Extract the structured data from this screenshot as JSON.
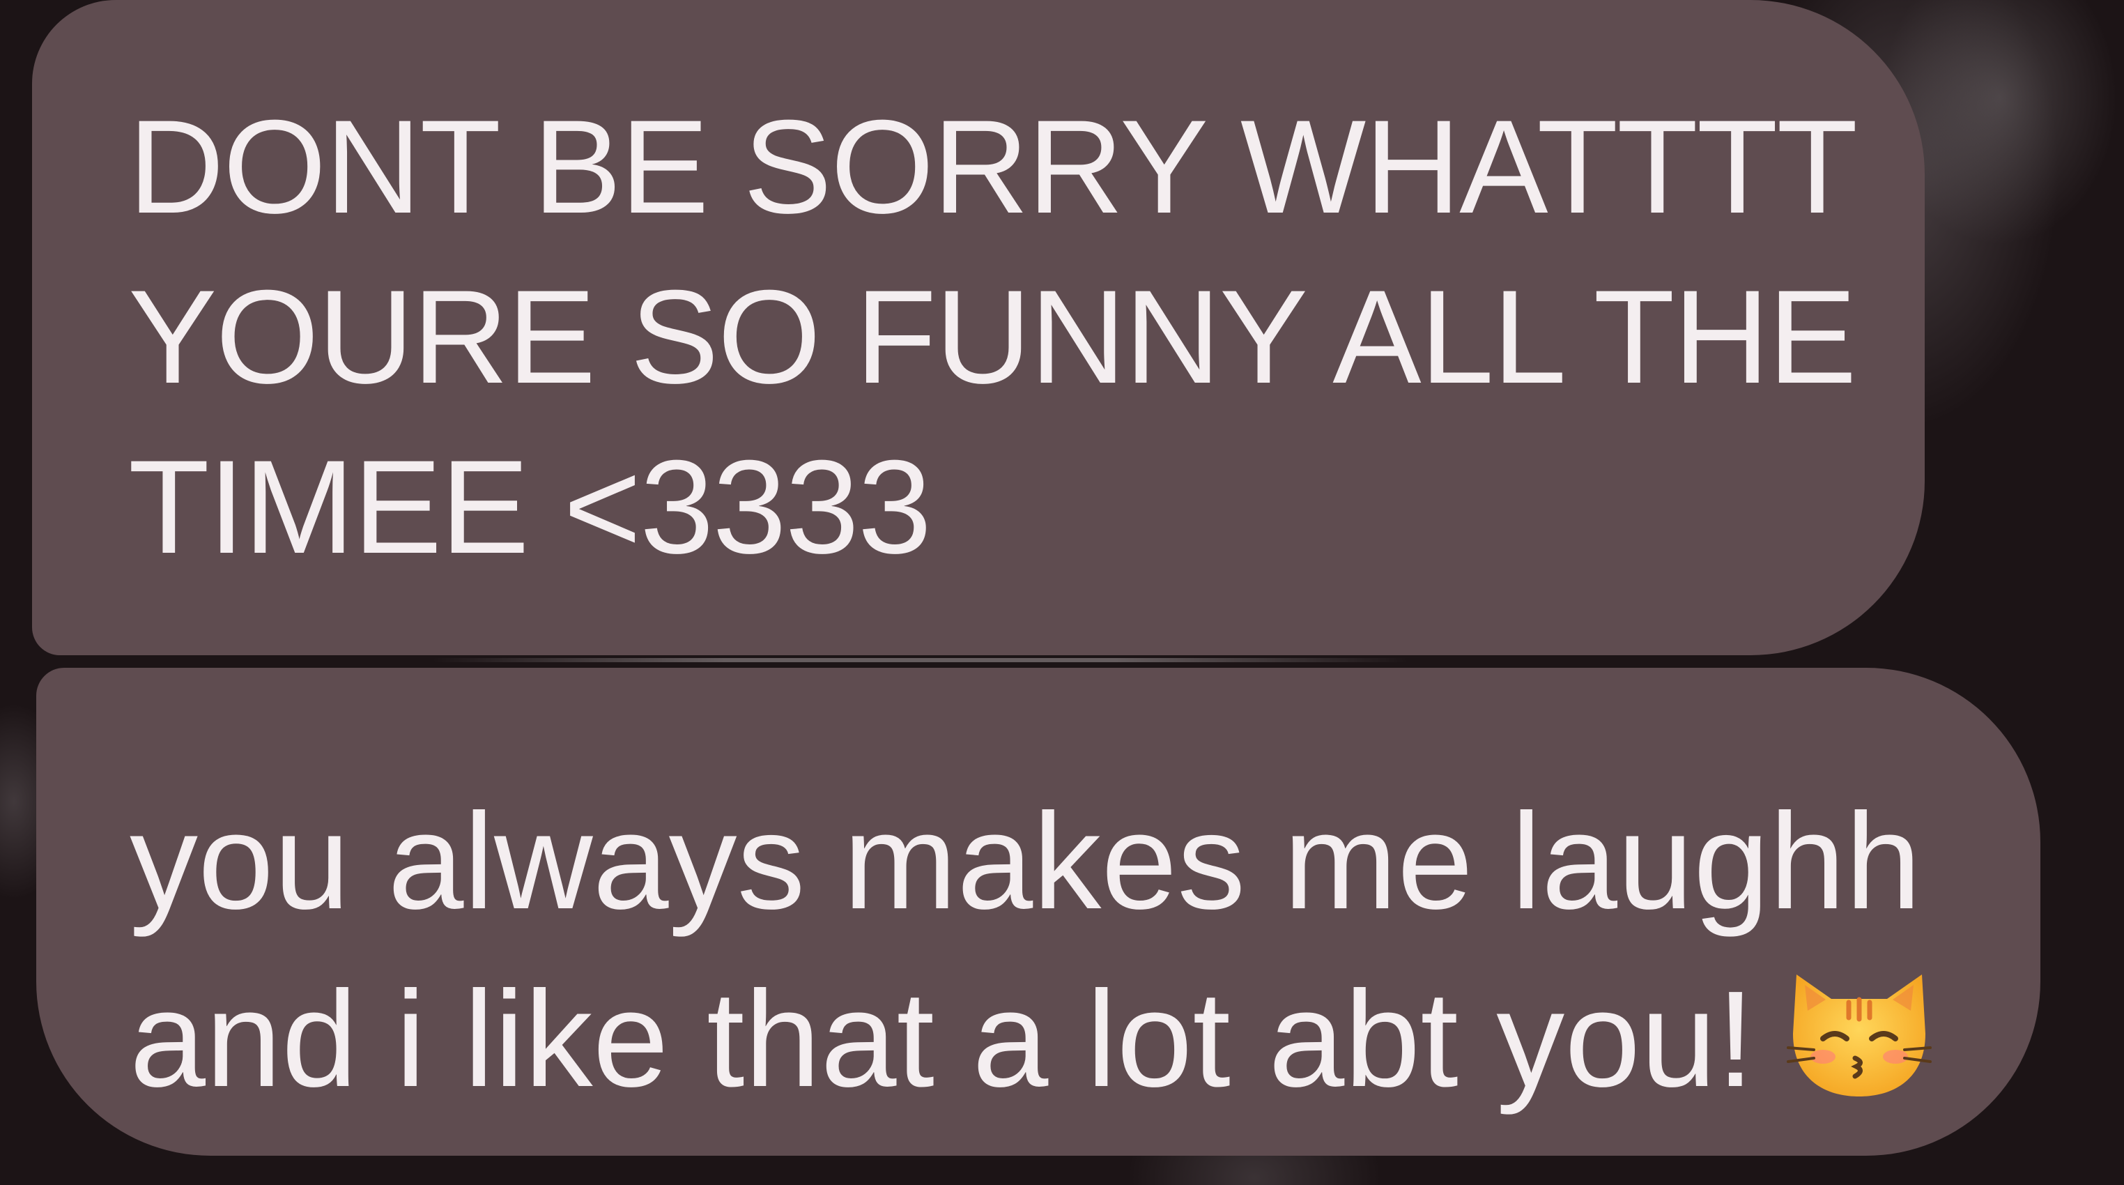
{
  "conversation": {
    "messages": [
      {
        "lines": [
          "DONT BE SORRY WHATTTT",
          "YOURE SO FUNNY ALL THE",
          "TIMEE <3333"
        ]
      },
      {
        "lines": [
          "you always makes me laughh",
          "and i like that a lot abt you!"
        ],
        "emoji": "kissing-cat-face-icon"
      }
    ]
  },
  "colors": {
    "bubble": "#5f4c50",
    "text": "#f4eef0",
    "background": "#1c1416"
  }
}
